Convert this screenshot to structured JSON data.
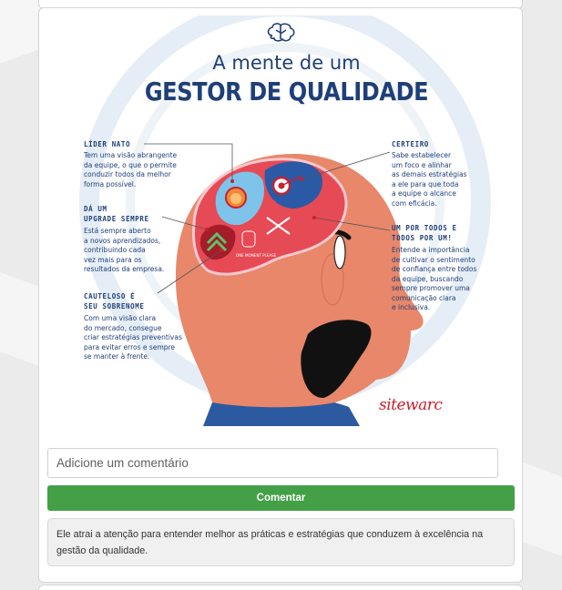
{
  "infographic": {
    "title_line1": "A mente de um",
    "title_line2": "GESTOR DE QUALIDADE",
    "brand": "sitewarc",
    "traits": [
      {
        "title_lines": [
          "LÍDER NATO"
        ],
        "desc_lines": [
          "Tem uma visão abrangente",
          "da equipe, o que o permite",
          "conduzir todos da melhor",
          "forma possível."
        ]
      },
      {
        "title_lines": [
          "DÁ UM",
          "UPGRADE SEMPRE"
        ],
        "desc_lines": [
          "Está sempre aberto",
          "a novos aprendizados,",
          "contribuindo cada",
          "vez mais para os",
          "resultados da empresa."
        ]
      },
      {
        "title_lines": [
          "CAUTELOSO É",
          "SEU SOBRENOME"
        ],
        "desc_lines": [
          "Com uma visão clara",
          "do mercado, consegue",
          "criar estratégias preventivas",
          "para evitar erros e sempre",
          "se manter à frente."
        ]
      },
      {
        "title_lines": [
          "CERTEIRO"
        ],
        "desc_lines": [
          "Sabe estabelecer",
          "um foco e alinhar",
          "as demais estratégias",
          "a ele para que toda",
          "a equipe o alcance",
          "com eficácia."
        ]
      },
      {
        "title_lines": [
          "UM POR TODOS E",
          "TODOS POR UM!"
        ],
        "desc_lines": [
          "Entende a importância",
          "de cultivar o sentimento",
          "de confiança entre todos",
          "da equipe, buscando",
          "sempre promover uma",
          "comunicação clara",
          "e inclusiva."
        ]
      }
    ],
    "hand_sign": "ONE MOMENT PLEASE",
    "colors": {
      "navy": "#1f3f78",
      "red": "#c8202f",
      "skin": "#e8876a",
      "brain": "#e64a55",
      "blue_section": "#2a5aa5",
      "light_blue": "#7ec3ea",
      "dark_red": "#a51d2a"
    }
  },
  "comment": {
    "placeholder": "Adicione um comentário",
    "button_label": "Comentar"
  },
  "post_caption": "Ele atrai a atenção para entender melhor as práticas e estratégias que conduzem à excelência na gestão da qualidade."
}
